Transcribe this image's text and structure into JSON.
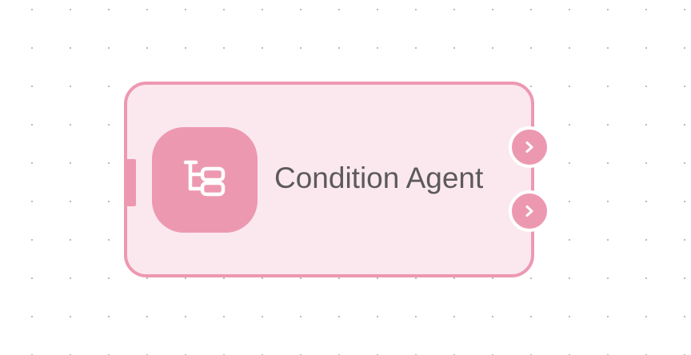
{
  "node": {
    "title": "Condition Agent",
    "icon": "condition-tree-icon",
    "handles": {
      "input": "input-handle",
      "outputs": [
        "chevron-right-icon",
        "chevron-right-icon"
      ]
    }
  },
  "colors": {
    "accent": "#ed98b1",
    "node_background": "#fbe8ee",
    "title_text": "#5c5a5b",
    "canvas_background": "#ffffff",
    "grid_dot": "#b8b8b8"
  }
}
